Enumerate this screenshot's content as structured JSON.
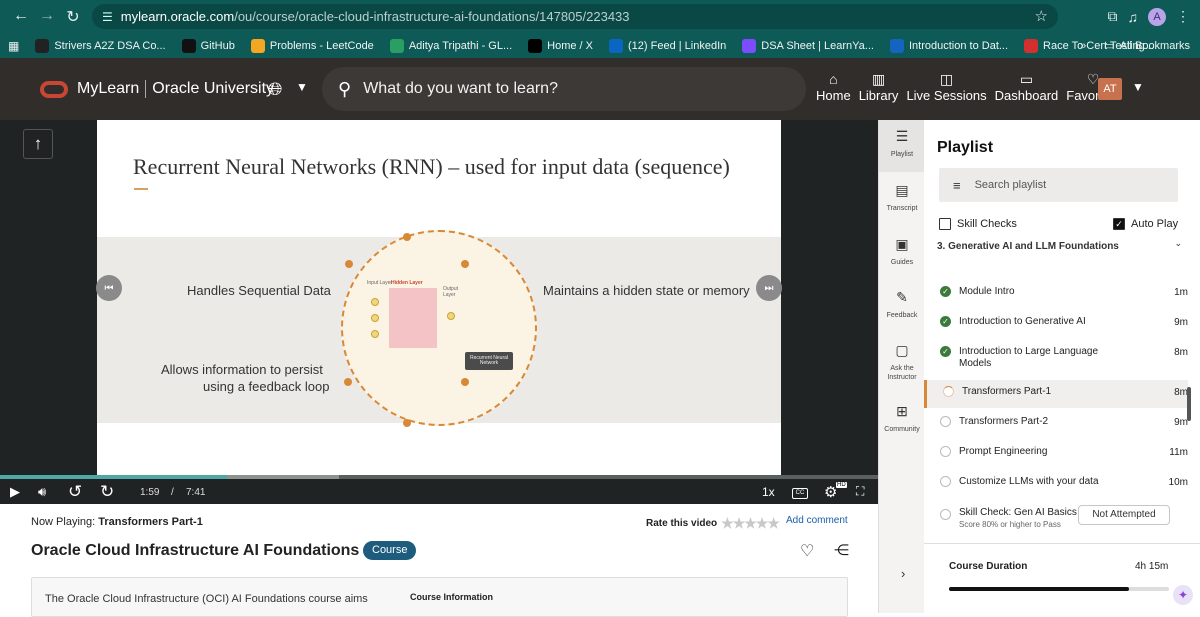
{
  "browser": {
    "url_host": "mylearn.oracle.com",
    "url_path": "/ou/course/oracle-cloud-infrastructure-ai-foundations/147805/223433",
    "profile_initial": "A",
    "bookmarks": [
      {
        "label": "Strivers A2Z DSA Co...",
        "icon_color": "#222"
      },
      {
        "label": "GitHub",
        "icon_color": "#111"
      },
      {
        "label": "Problems - LeetCode",
        "icon_color": "#f5a623"
      },
      {
        "label": "Aditya Tripathi - GL...",
        "icon_color": "#2b9e62"
      },
      {
        "label": "Home / X",
        "icon_color": "#000"
      },
      {
        "label": "(12) Feed | LinkedIn",
        "icon_color": "#0a66c2"
      },
      {
        "label": "DSA Sheet | LearnYa...",
        "icon_color": "#7c4dff"
      },
      {
        "label": "Introduction to Dat...",
        "icon_color": "#1565c0"
      },
      {
        "label": "Race To Cert Testing...",
        "icon_color": "#d32f2f"
      }
    ],
    "all_bookmarks": "All Bookmarks"
  },
  "header": {
    "brand_primary": "MyLearn",
    "brand_secondary": "Oracle University",
    "search_placeholder": "What do you want to learn?",
    "nav": [
      {
        "label": "Home",
        "icon": "home-icon"
      },
      {
        "label": "Library",
        "icon": "library-icon"
      },
      {
        "label": "Live Sessions",
        "icon": "live-sessions-icon"
      },
      {
        "label": "Dashboard",
        "icon": "dashboard-icon"
      },
      {
        "label": "Favorites",
        "icon": "heart-icon"
      }
    ],
    "user_initials": "AT"
  },
  "slide": {
    "title": "Recurrent Neural Networks (RNN) – used for input data (sequence)",
    "left_top": "Handles Sequential Data",
    "right_top": "Maintains a hidden state or memory",
    "left_bottom_1": "Allows information to persist",
    "left_bottom_2": "using a feedback loop",
    "nn_input": "Input Layer",
    "nn_hidden": "Hidden Layer",
    "nn_output": "Output Layer",
    "nn_badge": "Recurrent Neural Network"
  },
  "player": {
    "current_time": "1:59",
    "separator": "/",
    "total_time": "7:41",
    "speed": "1x",
    "cc": "CC",
    "hd": "HD",
    "played_fraction": 0.258
  },
  "below_video": {
    "now_playing_label": "Now Playing:",
    "now_playing_title": "Transformers Part-1",
    "rate_label": "Rate this video",
    "add_comment": "Add comment",
    "course_title": "Oracle Cloud Infrastructure AI Foundations",
    "course_badge": "Course",
    "description": "The Oracle Cloud Infrastructure (OCI) AI Foundations course aims",
    "course_info": "Course Information"
  },
  "rail": [
    {
      "label": "Playlist",
      "icon": "playlist-icon"
    },
    {
      "label": "Transcript",
      "icon": "transcript-icon"
    },
    {
      "label": "Guides",
      "icon": "guides-icon"
    },
    {
      "label": "Feedback",
      "icon": "feedback-icon"
    },
    {
      "label": "Ask the Instructor",
      "icon": "chat-icon"
    },
    {
      "label": "Community",
      "icon": "community-icon"
    }
  ],
  "playlist": {
    "title": "Playlist",
    "search_placeholder": "Search playlist",
    "skill_checks": "Skill Checks",
    "auto_play": "Auto Play",
    "section": "3. Generative AI and LLM Foundations",
    "lessons": [
      {
        "name": "Module Intro",
        "duration": "1m",
        "status": "done"
      },
      {
        "name": "Introduction to Generative AI",
        "duration": "9m",
        "status": "done"
      },
      {
        "name": "Introduction to Large Language Models",
        "duration": "8m",
        "status": "done"
      },
      {
        "name": "Transformers Part-1",
        "duration": "8m",
        "status": "progress"
      },
      {
        "name": "Transformers Part-2",
        "duration": "9m",
        "status": "todo"
      },
      {
        "name": "Prompt Engineering",
        "duration": "11m",
        "status": "todo"
      },
      {
        "name": "Customize LLMs with your data",
        "duration": "10m",
        "status": "todo"
      }
    ],
    "skill_check_name": "Skill Check: Gen AI Basics",
    "skill_check_sub": "Score 80% or higher to Pass",
    "skill_check_status": "Not Attempted",
    "duration_label": "Course Duration",
    "duration_value": "4h 15m",
    "duration_fraction": 0.82
  }
}
